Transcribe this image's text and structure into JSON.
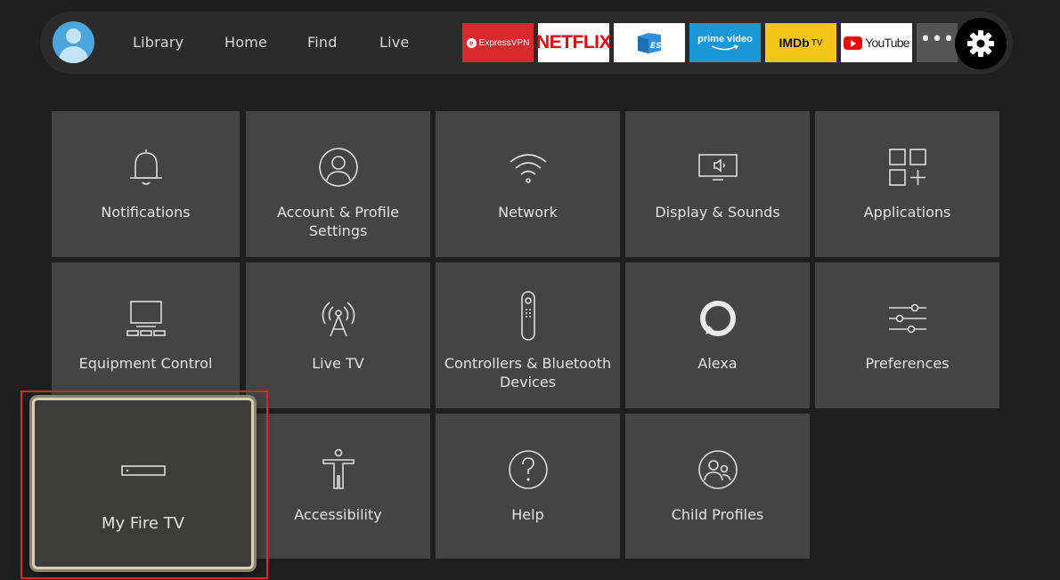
{
  "nav": {
    "items": [
      "Library",
      "Home",
      "Find",
      "Live"
    ]
  },
  "apps": {
    "expressvpn": "ExpressVPN",
    "netflix": "NETFLIX",
    "es": "ES",
    "prime_line1": "prime video",
    "imdb": "IMDb",
    "imdb_suffix": "TV",
    "youtube": "YouTube",
    "more": "•••"
  },
  "tiles": [
    {
      "label": "Notifications",
      "icon": "bell-icon"
    },
    {
      "label": "Account & Profile Settings",
      "icon": "user-circle-icon"
    },
    {
      "label": "Network",
      "icon": "wifi-icon"
    },
    {
      "label": "Display & Sounds",
      "icon": "tv-speaker-icon"
    },
    {
      "label": "Applications",
      "icon": "apps-grid-icon"
    },
    {
      "label": "Equipment Control",
      "icon": "monitor-icon"
    },
    {
      "label": "Live TV",
      "icon": "antenna-icon"
    },
    {
      "label": "Controllers & Bluetooth Devices",
      "icon": "remote-icon"
    },
    {
      "label": "Alexa",
      "icon": "alexa-ring-icon"
    },
    {
      "label": "Preferences",
      "icon": "sliders-icon"
    },
    {
      "label": "My Fire TV",
      "icon": "fire-tv-stick-icon",
      "focused": true
    },
    {
      "label": "Accessibility",
      "icon": "accessibility-person-icon"
    },
    {
      "label": "Help",
      "icon": "help-question-icon"
    },
    {
      "label": "Child Profiles",
      "icon": "child-profiles-icon"
    }
  ],
  "colors": {
    "background": "#1f1f1f",
    "tile": "#444444",
    "highlight": "#e0262b",
    "focus_border": "#d9cfb7"
  }
}
